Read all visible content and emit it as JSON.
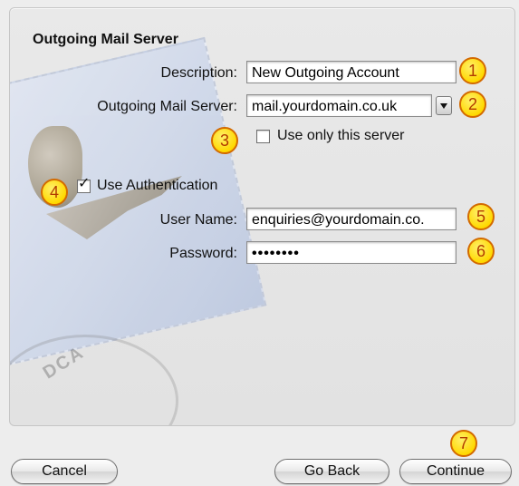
{
  "section_title": "Outgoing Mail Server",
  "description": {
    "label": "Description:",
    "value": "New Outgoing Account"
  },
  "outgoing_server": {
    "label": "Outgoing Mail Server:",
    "value": "mail.yourdomain.co.uk"
  },
  "use_only_this_server": {
    "label": "Use only this server",
    "checked": false
  },
  "use_authentication": {
    "label": "Use Authentication",
    "checked": true
  },
  "user_name": {
    "label": "User Name:",
    "value": "enquiries@yourdomain.co."
  },
  "password": {
    "label": "Password:",
    "value": "••••••••"
  },
  "stamp_text": "DCA",
  "badges": [
    "1",
    "2",
    "3",
    "4",
    "5",
    "6",
    "7"
  ],
  "buttons": {
    "cancel": "Cancel",
    "go_back": "Go Back",
    "continue": "Continue"
  }
}
